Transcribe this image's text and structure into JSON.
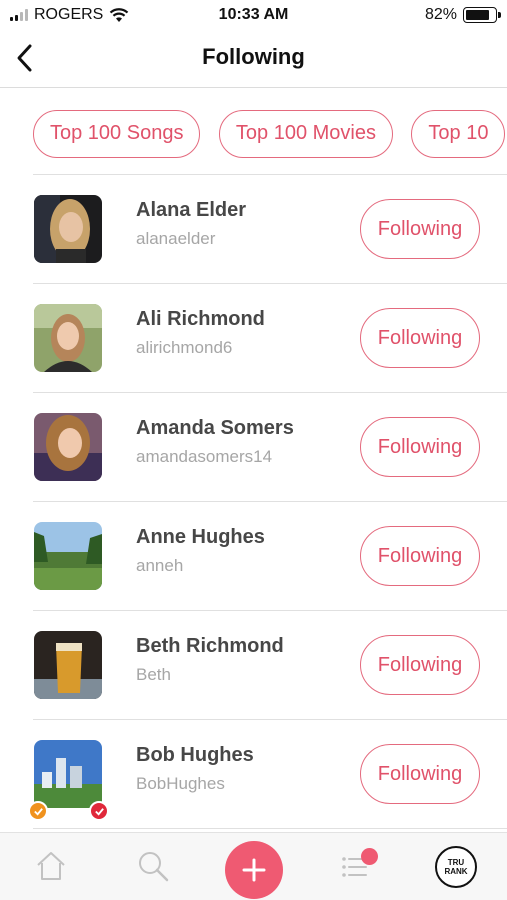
{
  "status_bar": {
    "carrier": "ROGERS",
    "time": "10:33 AM",
    "battery": "82%",
    "battery_level": 0.82,
    "signal_bars": 2
  },
  "nav": {
    "title": "Following",
    "back_icon": "chevron-left-icon"
  },
  "chips": [
    {
      "label": "Top 100 Songs"
    },
    {
      "label": "Top 100 Movies"
    },
    {
      "label": "Top 10"
    }
  ],
  "users": [
    {
      "name": "Alana Elder",
      "username": "alanaelder",
      "button": "Following"
    },
    {
      "name": "Ali Richmond",
      "username": "alirichmond6",
      "button": "Following"
    },
    {
      "name": "Amanda Somers",
      "username": "amandasomers14",
      "button": "Following"
    },
    {
      "name": "Anne Hughes",
      "username": "anneh",
      "button": "Following"
    },
    {
      "name": "Beth Richmond",
      "username": "Beth",
      "button": "Following"
    },
    {
      "name": "Bob Hughes",
      "username": "BobHughes",
      "button": "Following"
    }
  ],
  "tab_bar": {
    "home_icon": "home-icon",
    "search_icon": "search-icon",
    "add_icon": "plus-icon",
    "list_icon": "list-icon",
    "logo_text_top": "TRU",
    "logo_text_bottom": "RANK"
  },
  "colors": {
    "accent": "#e0526a",
    "accent_fill": "#ef5a72",
    "badge_orange": "#f0921e",
    "badge_red": "#e0283a"
  }
}
